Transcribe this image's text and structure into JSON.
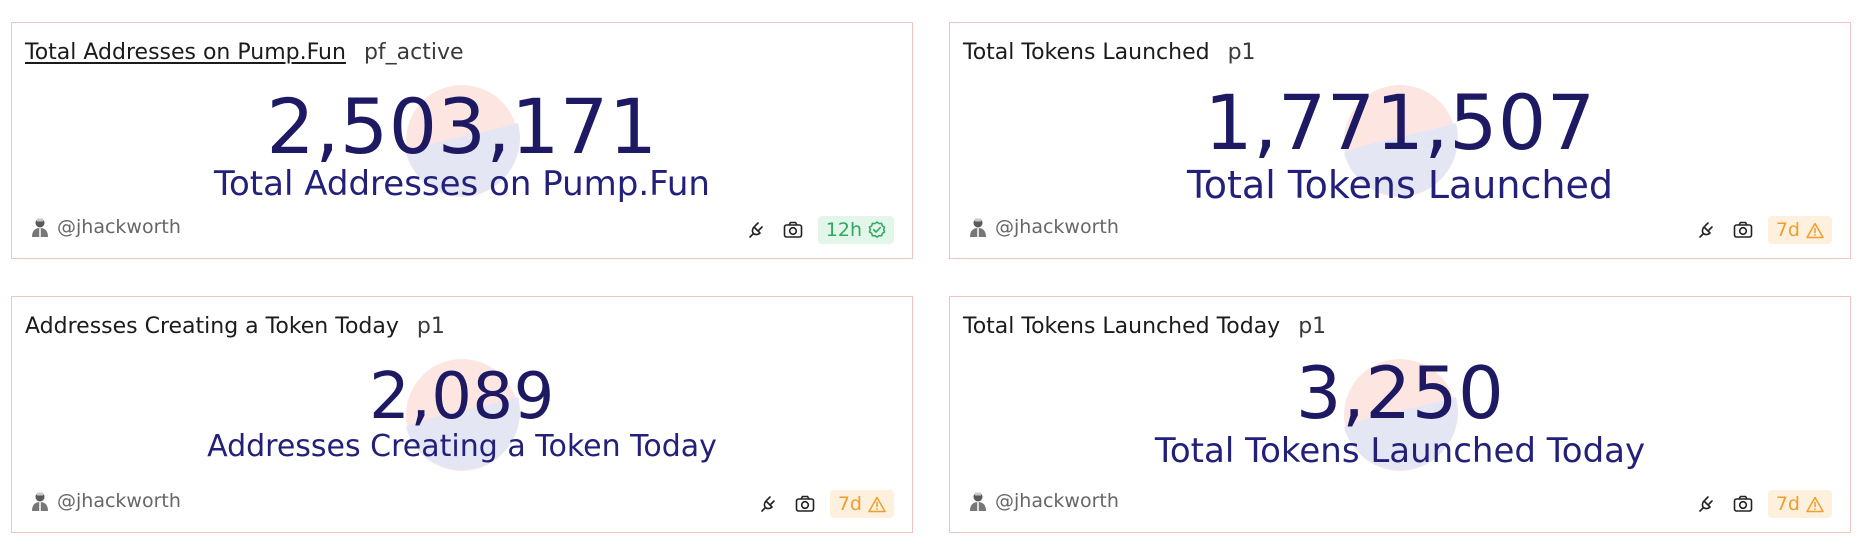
{
  "colors": {
    "number": "#1d1a63",
    "label": "#23207a",
    "card_border": "#f2c4c1",
    "badge_ok_bg": "#e3f6ea",
    "badge_ok_fg": "#2fa862",
    "badge_warn_bg": "#fdf1de",
    "badge_warn_fg": "#ef9d2e"
  },
  "cards": [
    {
      "title": "Total Addresses on Pump.Fun",
      "tag": "pf_active",
      "value": "2,503,171",
      "label": "Total Addresses on Pump.Fun",
      "author": "@jhackworth",
      "freshness": "12h",
      "status": "ok",
      "status_icon": "check-badge-icon"
    },
    {
      "title": "Total Tokens Launched",
      "tag": "p1",
      "value": "1,771,507",
      "label": "Total Tokens Launched",
      "author": "@jhackworth",
      "freshness": "7d",
      "status": "warn",
      "status_icon": "warning-icon"
    },
    {
      "title": "Addresses Creating a Token Today",
      "tag": "p1",
      "value": "2,089",
      "label": "Addresses Creating a Token Today",
      "author": "@jhackworth",
      "freshness": "7d",
      "status": "warn",
      "status_icon": "warning-icon"
    },
    {
      "title": "Total Tokens Launched Today",
      "tag": "p1",
      "value": "3,250",
      "label": "Total Tokens Launched Today",
      "author": "@jhackworth",
      "freshness": "7d",
      "status": "warn",
      "status_icon": "warning-icon"
    }
  ]
}
